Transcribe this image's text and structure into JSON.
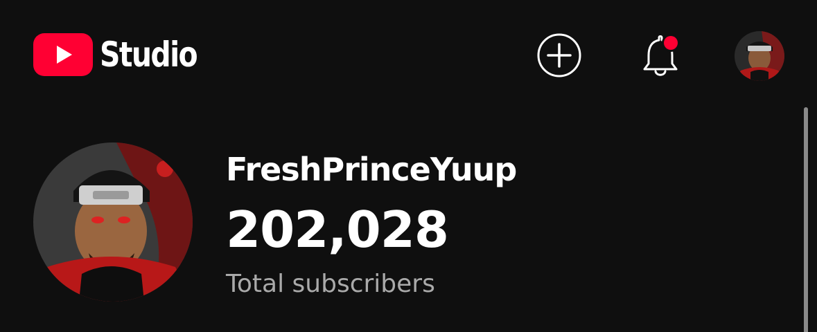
{
  "app": {
    "logo_text": "Studio"
  },
  "header": {
    "create_icon": "add-circle-icon",
    "notifications_icon": "bell-icon",
    "notification_dot_color": "#ff0033",
    "account_icon": "avatar"
  },
  "channel": {
    "name": "FreshPrinceYuup",
    "subscriber_count": "202,028",
    "subscriber_label": "Total subscribers"
  },
  "colors": {
    "background": "#0f0f0f",
    "brand_red": "#ff0033",
    "text_primary": "#ffffff",
    "text_secondary": "#aaaaaa"
  }
}
